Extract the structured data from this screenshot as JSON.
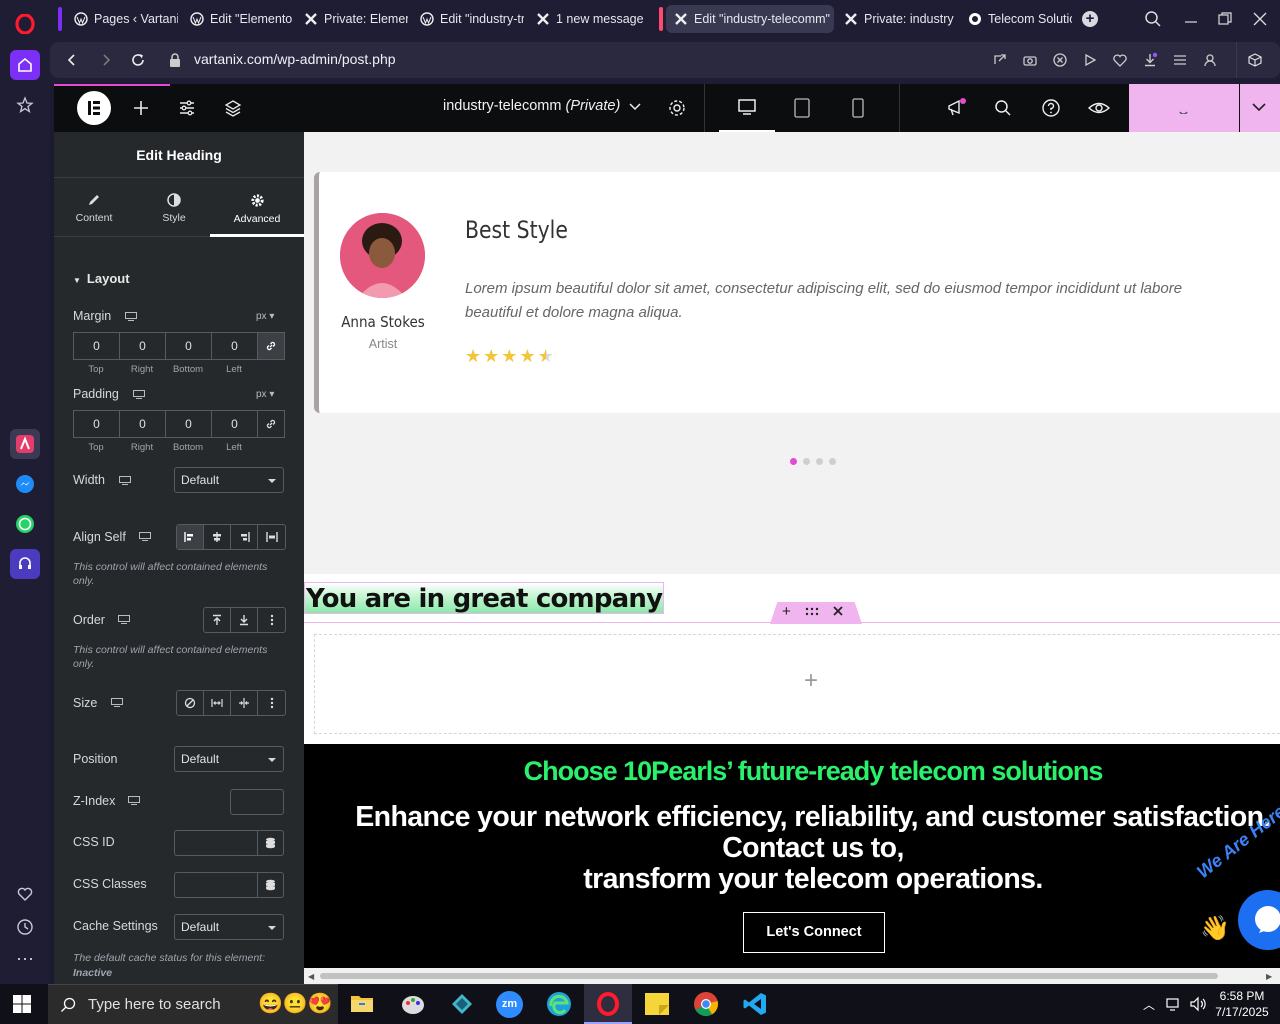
{
  "browser": {
    "tabs": [
      {
        "label": "Pages ‹ Vartanix",
        "icon": "wordpress-icon"
      },
      {
        "label": "Edit \"Elementor",
        "icon": "wordpress-icon"
      },
      {
        "label": "Private: Element",
        "icon": "elementor-x-icon"
      },
      {
        "label": "Edit \"industry-tr",
        "icon": "wordpress-icon"
      },
      {
        "label": "1 new message",
        "icon": "elementor-x-icon"
      },
      {
        "label": "Edit \"industry-telecomm\"",
        "icon": "elementor-x-icon",
        "active": true
      },
      {
        "label": "Private: industry",
        "icon": "elementor-x-icon"
      },
      {
        "label": "Telecom Solutio",
        "icon": "site-favicon"
      }
    ],
    "url": "vartanix.com/wp-admin/post.php"
  },
  "elementor_topbar": {
    "page_title": "industry-telecomm",
    "page_status": "(Private)"
  },
  "panel": {
    "title": "Edit Heading",
    "tabs": [
      {
        "label": "Content",
        "icon": "pencil-icon"
      },
      {
        "label": "Style",
        "icon": "contrast-icon"
      },
      {
        "label": "Advanced",
        "icon": "gear-icon",
        "active": true
      }
    ],
    "section_title": "Layout",
    "margin": {
      "label": "Margin",
      "unit": "px",
      "values": [
        "0",
        "0",
        "0",
        "0"
      ],
      "sides": [
        "Top",
        "Right",
        "Bottom",
        "Left"
      ]
    },
    "padding": {
      "label": "Padding",
      "unit": "px",
      "values": [
        "0",
        "0",
        "0",
        "0"
      ],
      "sides": [
        "Top",
        "Right",
        "Bottom",
        "Left"
      ]
    },
    "width": {
      "label": "Width",
      "value": "Default"
    },
    "align_self": {
      "label": "Align Self",
      "note": "This control will affect contained elements only."
    },
    "order": {
      "label": "Order",
      "note": "This control will affect contained elements only."
    },
    "size": {
      "label": "Size"
    },
    "position": {
      "label": "Position",
      "value": "Default"
    },
    "zindex": {
      "label": "Z-Index",
      "value": ""
    },
    "css_id": {
      "label": "CSS ID",
      "value": ""
    },
    "css_classes": {
      "label": "CSS Classes",
      "value": ""
    },
    "cache": {
      "label": "Cache Settings",
      "value": "Default",
      "note": "The default cache status for this element:",
      "status": "Inactive"
    }
  },
  "canvas": {
    "testimonial": {
      "name": "Anna Stokes",
      "role": "Artist",
      "title": "Best Style",
      "text": "Lorem ipsum beautiful dolor sit amet, consectetur adipiscing elit, sed do eiusmod tempor incididunt ut labore beautiful et dolore magna aliqua.",
      "rating": 4.5,
      "slides": 4,
      "active_slide": 1
    },
    "heading": "You are in great company",
    "cta": {
      "headline": "Choose 10Pearls’ future-ready telecom solutions",
      "line1": "Enhance your network efficiency, reliability, and customer satisfaction.",
      "line2": "Contact us to,",
      "line3": "transform your telecom operations.",
      "button": "Let's Connect"
    },
    "badge_text": "We Are Here"
  },
  "taskbar": {
    "search_placeholder": "Type here to search",
    "time": "6:58 PM",
    "date": "7/17/2025"
  },
  "colors": {
    "accent_pink": "#f0b4ee",
    "heading_green": "#2bf06b",
    "star": "#f3c53a",
    "elementor_dark": "#0c0d0e",
    "panel": "#26292c",
    "opera_red": "#ff1b2d"
  }
}
